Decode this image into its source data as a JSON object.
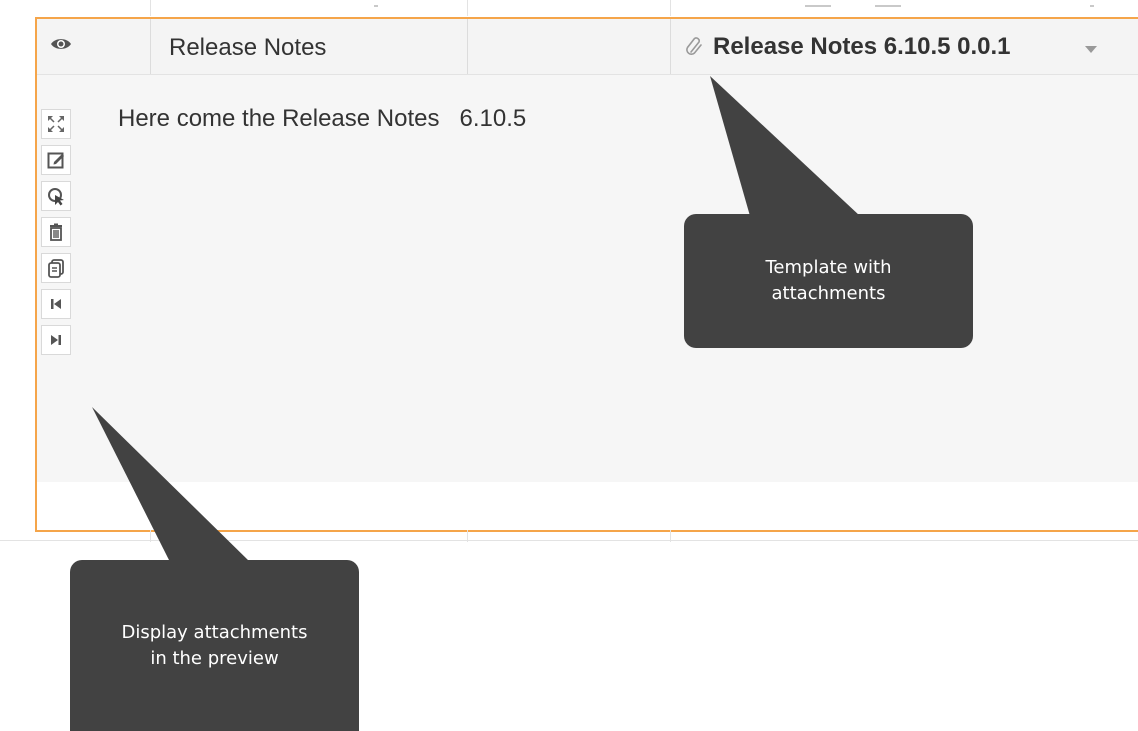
{
  "row": {
    "title": "Release Notes",
    "template_name": "Release Notes 6.10.5 0.0.1"
  },
  "preview": {
    "text": "Here come the Release Notes   6.10.5"
  },
  "toolbar": {
    "icons": [
      "expand-icon",
      "edit-icon",
      "select-icon",
      "delete-icon",
      "copy-icon",
      "first-icon",
      "last-icon"
    ]
  },
  "callouts": {
    "template_attachments": [
      "Template with",
      "attachments"
    ],
    "display_attachments": [
      "Display attachments",
      "in the preview"
    ]
  },
  "colors": {
    "selection_border": "#f5a54a",
    "callout_background": "#424242",
    "header_background": "#f4f4f4",
    "preview_background": "#f6f6f6"
  }
}
